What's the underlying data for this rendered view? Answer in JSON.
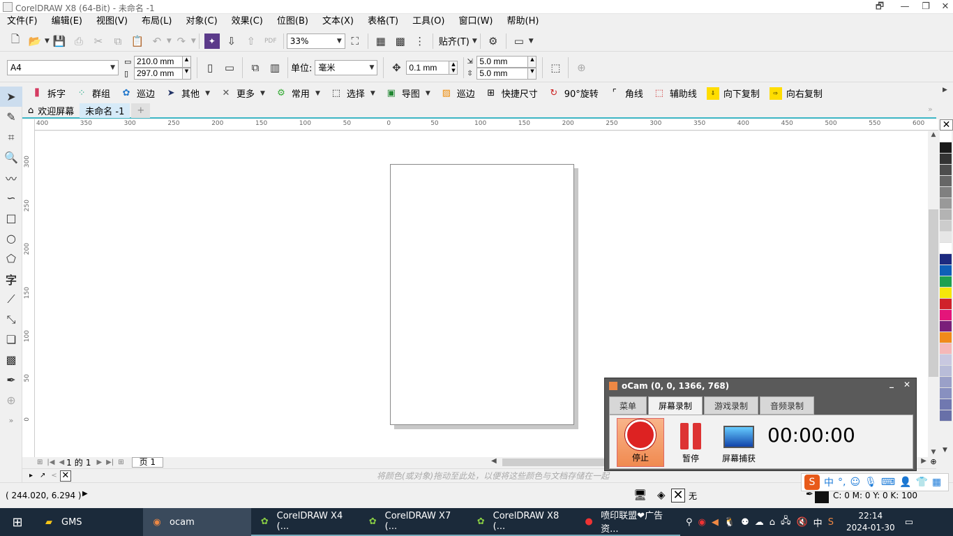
{
  "window": {
    "title": "CorelDRAW X8 (64-Bit) - 未命名 -1",
    "min": "—",
    "restore": "❐",
    "close": "✕",
    "extra": "🗗"
  },
  "menu": [
    "文件(F)",
    "编辑(E)",
    "视图(V)",
    "布局(L)",
    "对象(C)",
    "效果(C)",
    "位图(B)",
    "文本(X)",
    "表格(T)",
    "工具(O)",
    "窗口(W)",
    "帮助(H)"
  ],
  "standard_toolbar": {
    "zoom": "33%",
    "snap_label": "贴齐(T)"
  },
  "property_bar": {
    "page_size": "A4",
    "width": "210.0 mm",
    "height": "297.0 mm",
    "unit_label": "单位:",
    "unit": "毫米",
    "nudge": "0.1 mm",
    "dup_x": "5.0 mm",
    "dup_y": "5.0 mm"
  },
  "plugin_bar": [
    {
      "label": "拆字",
      "icon": "split-icon"
    },
    {
      "label": "群组",
      "icon": "group-icon"
    },
    {
      "label": "巡边",
      "icon": "outline-icon"
    },
    {
      "label": "其他",
      "icon": "cursor-icon",
      "dropdown": true
    },
    {
      "label": "更多",
      "icon": "tools-icon",
      "dropdown": true
    },
    {
      "label": "常用",
      "icon": "gear-icon",
      "dropdown": true
    },
    {
      "label": "选择",
      "icon": "select-icon",
      "dropdown": true
    },
    {
      "label": "导图",
      "icon": "image-icon",
      "dropdown": true
    },
    {
      "label": "巡边",
      "icon": "outline2-icon"
    },
    {
      "label": "快捷尺寸",
      "icon": "size-icon"
    },
    {
      "label": "90°旋转",
      "icon": "rotate-icon"
    },
    {
      "label": "角线",
      "icon": "corner-icon"
    },
    {
      "label": "辅助线",
      "icon": "guide-icon"
    },
    {
      "label": "向下复制",
      "icon": "copy-down-icon"
    },
    {
      "label": "向右复制",
      "icon": "copy-right-icon"
    }
  ],
  "doc_tabs": {
    "welcome": "欢迎屏幕",
    "doc": "未命名 -1",
    "add": "+"
  },
  "rulers": {
    "h": [
      "400",
      "350",
      "300",
      "250",
      "200",
      "150",
      "100",
      "50",
      "0",
      "50",
      "100",
      "150",
      "200",
      "250",
      "300",
      "350",
      "400",
      "450",
      "500",
      "550",
      "600"
    ],
    "v": [
      "300",
      "250",
      "200",
      "150",
      "100",
      "50",
      "0"
    ],
    "unit_corner": "毫米"
  },
  "page_nav": {
    "current": "1",
    "of": "的",
    "total": "1",
    "page_tab": "页 1"
  },
  "doc_palette_hint": "将颜色(或对象)拖动至此处，以便将这些颜色与文档存储在一起",
  "status": {
    "coords": "( 244.020, 6.294 )",
    "fill_none": "无",
    "outline_color": "C: 0 M: 0 Y: 0 K: 100"
  },
  "ocam": {
    "title": "oCam (0, 0, 1366, 768)",
    "tabs": [
      "菜单",
      "屏幕录制",
      "游戏录制",
      "音频录制"
    ],
    "stop": "停止",
    "pause": "暂停",
    "capture": "屏幕捕获",
    "timer": "00:00:00"
  },
  "palette_colors": [
    "#ffffff",
    "#1a1a1a",
    "#333333",
    "#4d4d4d",
    "#666666",
    "#808080",
    "#999999",
    "#b3b3b3",
    "#cccccc",
    "#e6e6e6",
    "#ffffff",
    "#1d2a80",
    "#0f5fb8",
    "#1fa050",
    "#f5e60a",
    "#d0222a",
    "#e4157a",
    "#7a1f7a",
    "#f08a1a",
    "#f5b8b8",
    "#c8c8e0",
    "#b8bcd8",
    "#9aa0c8",
    "#8890c0",
    "#7078b0",
    "#6870a8"
  ],
  "taskbar": {
    "items": [
      {
        "label": "GMS",
        "icon": "folder-icon"
      },
      {
        "label": "ocam",
        "icon": "ocam-icon"
      },
      {
        "label": "CorelDRAW X4 (...",
        "icon": "coreldraw-icon"
      },
      {
        "label": "CorelDRAW X7 (...",
        "icon": "coreldraw-icon"
      },
      {
        "label": "CorelDRAW X8 (...",
        "icon": "coreldraw-icon"
      },
      {
        "label": "喷印联盟❤广告资...",
        "icon": "app-icon"
      }
    ],
    "ime": "中",
    "time": "22:14",
    "date": "2024-01-30"
  }
}
